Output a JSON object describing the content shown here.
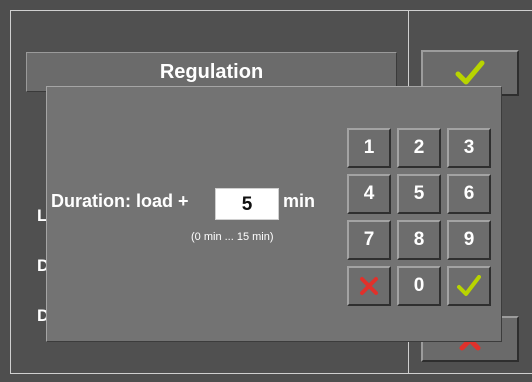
{
  "background": {
    "title": "Regulation",
    "labels": [
      "L",
      "D",
      "D"
    ]
  },
  "dialog": {
    "prompt": "Duration: load +",
    "value": "5",
    "unit": "min",
    "range": "(0 min ... 15 min)"
  },
  "keypad": {
    "keys": [
      "1",
      "2",
      "3",
      "4",
      "5",
      "6",
      "7",
      "8",
      "9"
    ],
    "zero": "0"
  },
  "colors": {
    "confirm": "#b8d400",
    "cancel": "#e0312b"
  },
  "icons": {
    "confirm": "check-icon",
    "cancel": "cross-icon"
  }
}
